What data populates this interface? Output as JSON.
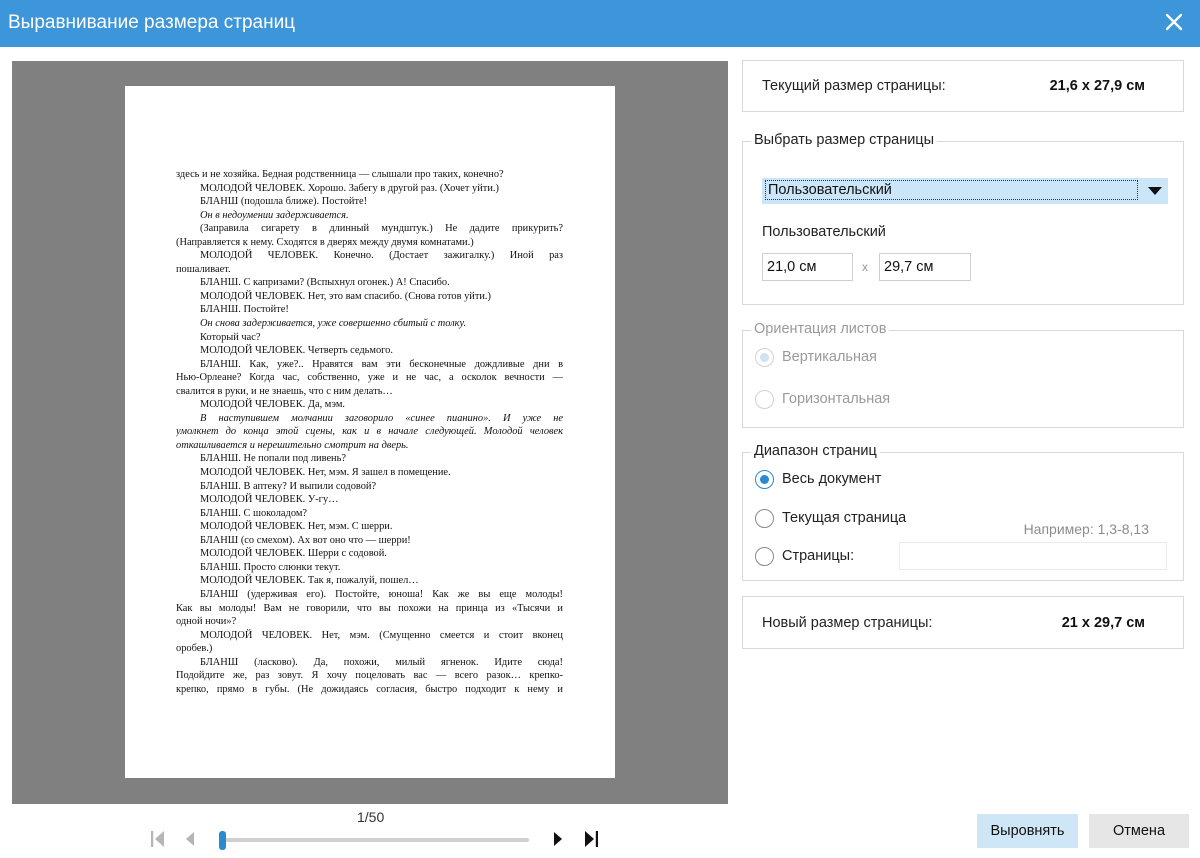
{
  "window": {
    "title": "Выравнивание размера страниц",
    "close_icon": "close-icon"
  },
  "document": {
    "lines": [
      {
        "text": "здесь и не хозяйка. Бедная родственница — слышали про таких, конечно?",
        "indent": false,
        "italic": false,
        "justify": false
      },
      {
        "text": "МОЛОДОЙ ЧЕЛОВЕК. Хорошо. Забегу в другой раз. (Хочет уйти.)",
        "indent": true,
        "italic": false,
        "justify": false
      },
      {
        "text": "БЛАНШ (подошла ближе). Постойте!",
        "indent": true,
        "italic": false,
        "justify": false
      },
      {
        "text": "Он в недоумении задерживается.",
        "indent": true,
        "italic": true,
        "justify": false
      },
      {
        "text": "(Заправила сигарету в длинный мундштук.) Не дадите прикурить?",
        "indent": true,
        "italic": false,
        "justify": true
      },
      {
        "text": "(Направляется к нему. Сходятся в дверях между двумя комнатами.)",
        "indent": false,
        "italic": false,
        "justify": false
      },
      {
        "text": "МОЛОДОЙ ЧЕЛОВЕК. Конечно. (Достает зажигалку.) Иной раз",
        "indent": true,
        "italic": false,
        "justify": true
      },
      {
        "text": "пошаливает.",
        "indent": false,
        "italic": false,
        "justify": false
      },
      {
        "text": "БЛАНШ. С капризами? (Вспыхнул огонек.) А! Спасибо.",
        "indent": true,
        "italic": false,
        "justify": false
      },
      {
        "text": "МОЛОДОЙ ЧЕЛОВЕК. Нет, это вам спасибо. (Снова готов уйти.)",
        "indent": true,
        "italic": false,
        "justify": false
      },
      {
        "text": "БЛАНШ. Постойте!",
        "indent": true,
        "italic": false,
        "justify": false
      },
      {
        "text": "Он снова задерживается, уже совершенно сбитый с толку.",
        "indent": true,
        "italic": true,
        "justify": false
      },
      {
        "text": "Который час?",
        "indent": true,
        "italic": false,
        "justify": false
      },
      {
        "text": "МОЛОДОЙ ЧЕЛОВЕК. Четверть седьмого.",
        "indent": true,
        "italic": false,
        "justify": false
      },
      {
        "text": "БЛАНШ. Как, уже?.. Нравятся вам эти бесконечные дождливые дни в",
        "indent": true,
        "italic": false,
        "justify": true
      },
      {
        "text": "Нью-Орлеане? Когда час, собственно, уже и не час, а осколок вечности —",
        "indent": false,
        "italic": false,
        "justify": true
      },
      {
        "text": "свалится в руки, и не знаешь, что с ним делать…",
        "indent": false,
        "italic": false,
        "justify": false
      },
      {
        "text": "МОЛОДОЙ ЧЕЛОВЕК. Да, мэм.",
        "indent": true,
        "italic": false,
        "justify": false
      },
      {
        "text": "В наступившем молчании заговорило «синее пианино». И уже не",
        "indent": true,
        "italic": true,
        "justify": true
      },
      {
        "text": "умолкнет до конца этой сцены, как и в начале следующей. Молодой человек",
        "indent": false,
        "italic": true,
        "justify": true
      },
      {
        "text": "откашливается и нерешительно смотрит на дверь.",
        "indent": false,
        "italic": true,
        "justify": false
      },
      {
        "text": "БЛАНШ. Не попали под ливень?",
        "indent": true,
        "italic": false,
        "justify": false
      },
      {
        "text": "МОЛОДОЙ ЧЕЛОВЕК. Нет, мэм. Я зашел в помещение.",
        "indent": true,
        "italic": false,
        "justify": false
      },
      {
        "text": "БЛАНШ. В аптеку? И выпили содовой?",
        "indent": true,
        "italic": false,
        "justify": false
      },
      {
        "text": "МОЛОДОЙ ЧЕЛОВЕК. У-гу…",
        "indent": true,
        "italic": false,
        "justify": false
      },
      {
        "text": "БЛАНШ. С шоколадом?",
        "indent": true,
        "italic": false,
        "justify": false
      },
      {
        "text": "МОЛОДОЙ ЧЕЛОВЕК. Нет, мэм. С шерри.",
        "indent": true,
        "italic": false,
        "justify": false
      },
      {
        "text": "БЛАНШ (со смехом). Ах вот оно что — шерри!",
        "indent": true,
        "italic": false,
        "justify": false
      },
      {
        "text": "МОЛОДОЙ ЧЕЛОВЕК. Шерри с содовой.",
        "indent": true,
        "italic": false,
        "justify": false
      },
      {
        "text": "БЛАНШ. Просто слюнки текут.",
        "indent": true,
        "italic": false,
        "justify": false
      },
      {
        "text": "МОЛОДОЙ ЧЕЛОВЕК. Так я, пожалуй, пошел…",
        "indent": true,
        "italic": false,
        "justify": false
      },
      {
        "text": "БЛАНШ (удерживая его). Постойте, юноша! Как же вы еще молоды!",
        "indent": true,
        "italic": false,
        "justify": true
      },
      {
        "text": "Как вы молоды! Вам не говорили, что вы похожи на принца из «Тысячи и",
        "indent": false,
        "italic": false,
        "justify": true
      },
      {
        "text": "одной ночи»?",
        "indent": false,
        "italic": false,
        "justify": false
      },
      {
        "text": "МОЛОДОЙ ЧЕЛОВЕК. Нет, мэм. (Смущенно смеется и стоит вконец",
        "indent": true,
        "italic": false,
        "justify": true
      },
      {
        "text": "оробев.)",
        "indent": false,
        "italic": false,
        "justify": false
      },
      {
        "text": "БЛАНШ (ласково). Да, похожи, милый ягненок. Идите сюда!",
        "indent": true,
        "italic": false,
        "justify": true
      },
      {
        "text": "Подойдите же, раз зовут. Я хочу поцеловать вас — всего разок… крепко-",
        "indent": false,
        "italic": false,
        "justify": true
      },
      {
        "text": "крепко, прямо в губы. (Не дожидаясь согласия, быстро подходит к нему и",
        "indent": false,
        "italic": false,
        "justify": true
      }
    ]
  },
  "navigation": {
    "page_indicator": "1/50",
    "current_page": 1,
    "total_pages": 50,
    "icons": [
      "first-page-icon",
      "previous-page-icon",
      "next-page-icon",
      "last-page-icon"
    ]
  },
  "current_size": {
    "label": "Текущий размер страницы:",
    "value": "21,6 x 27,9 см"
  },
  "choose_size": {
    "legend": "Выбрать размер страницы",
    "selected": "Пользовательский",
    "custom_label": "Пользовательский",
    "width": "21,0 см",
    "separator": "x",
    "height": "29,7 см"
  },
  "orientation": {
    "legend": "Ориентация листов",
    "portrait": "Вертикальная",
    "landscape": "Горизонтальная",
    "selected": "portrait",
    "enabled": false
  },
  "range": {
    "legend": "Диапазон страниц",
    "all": "Весь документ",
    "current": "Текущая страница",
    "pages": "Страницы:",
    "hint": "Например: 1,3-8,13",
    "pages_value": "",
    "selected": "all"
  },
  "new_size": {
    "label": "Новый размер страницы:",
    "value": "21 x 29,7 см"
  },
  "buttons": {
    "apply": "Выровнять",
    "cancel": "Отмена"
  },
  "colors": {
    "accent": "#3c96d9",
    "radio_selected": "#2b89d0",
    "select_highlight": "#cbe6f8",
    "preview_background": "#808080"
  }
}
